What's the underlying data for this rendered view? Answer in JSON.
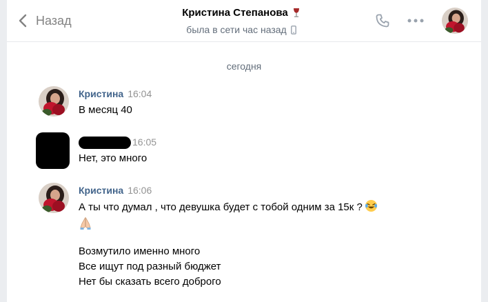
{
  "header": {
    "back_label": "Назад",
    "title": "Кристина Степанова",
    "status": "была в сети час назад",
    "title_icon": "wine-glass-icon",
    "status_icon": "mobile-phone-icon"
  },
  "chat": {
    "date_separator": "сегодня",
    "messages": [
      {
        "author": "Кристина",
        "time": "16:04",
        "lines": [
          "В месяц 40"
        ]
      },
      {
        "author": "",
        "time": "16:05",
        "lines": [
          "Нет, это много"
        ],
        "redacted": true
      },
      {
        "author": "Кристина",
        "time": "16:06",
        "lines": [
          "А ты что думал , что девушка будет с тобой одним за 15к ?"
        ],
        "emoji": [
          "face-with-tears-of-joy",
          "folded-hands"
        ],
        "extra_lines": [
          "Возмутило именно много",
          "Все ищут под разный бюджет",
          "Нет бы сказать всего доброго"
        ]
      }
    ]
  },
  "colors": {
    "accent": "#42648b",
    "muted": "#828282",
    "background": "#ebedf0"
  }
}
